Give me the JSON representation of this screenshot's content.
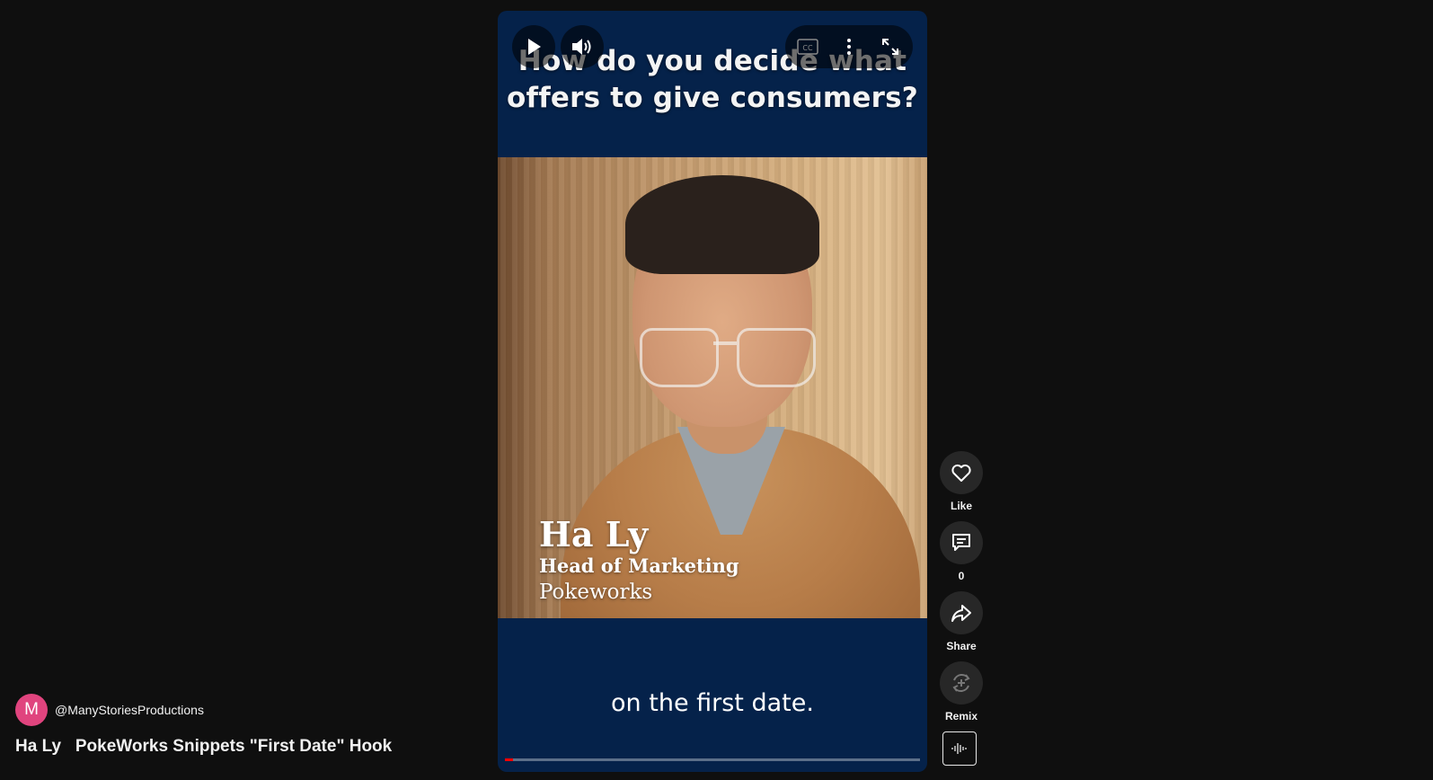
{
  "video": {
    "top_caption_line1": "How do you decide what",
    "top_caption_line2": "offers to give consumers?",
    "bottom_caption": "on the first date.",
    "lower_third": {
      "name": "Ha Ly",
      "role": "Head of Marketing",
      "company": "Pokeworks"
    },
    "progress": 0.02
  },
  "controls": {
    "play_icon": "play-icon",
    "volume_icon": "volume-icon",
    "cc_label": "CC",
    "more_icon": "more-vert-icon",
    "fullscreen_icon": "fullscreen-icon"
  },
  "actions": {
    "like_label": "Like",
    "comment_count": "0",
    "share_label": "Share",
    "remix_label": "Remix"
  },
  "channel": {
    "avatar_letter": "M",
    "handle": "@ManyStoriesProductions",
    "title": "Ha Ly   PokeWorks Snippets \"First Date\" Hook"
  },
  "colors": {
    "page_bg": "#0f0f0f",
    "player_bg": "#05224a",
    "avatar": "#e0447e",
    "progress": "#ff0000"
  }
}
